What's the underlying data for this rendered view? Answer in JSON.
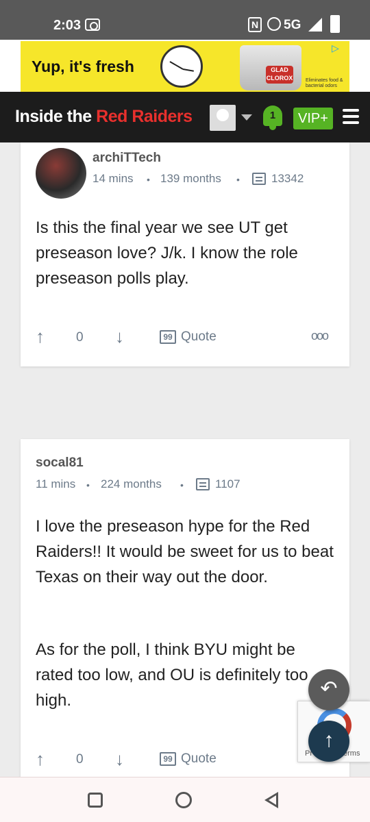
{
  "status_bar": {
    "time": "2:03",
    "network": "5G",
    "nfc_label": "N"
  },
  "ad": {
    "headline": "Yup, it's fresh",
    "brand": "GLAD",
    "sub_brand": "CLOROX",
    "fine_print": "Eliminates food & bacterial odors",
    "choice_icon": "adchoices-icon"
  },
  "site": {
    "name_white": "Inside the",
    "name_red": "Red Raiders",
    "notification_count": "1",
    "vip_label": "VIP+",
    "accent_color": "#56b324",
    "brand_red": "#e8302d"
  },
  "posts": [
    {
      "username": "archiTTech",
      "time_ago": "14 mins",
      "member_for": "139 months",
      "post_count": "13342",
      "paragraphs": [
        "Is this the final year we see UT get preseason love? J/k. I know the role preseason polls play."
      ],
      "votes": "0",
      "quote_label": "Quote",
      "more_label": "ooo"
    },
    {
      "username": "socal81",
      "time_ago": "11 mins",
      "member_for": "224 months",
      "post_count": "1107",
      "paragraphs": [
        "I love the preseason hype for the Red Raiders!! It would be sweet for us to beat Texas on their way out the door.",
        "As for the poll, I think BYU might be rated too low, and OU is definitely too high."
      ],
      "votes": "0",
      "quote_label": "Quote"
    }
  ],
  "recaptcha": {
    "left_text": "Pr",
    "right_text": "erms"
  },
  "fab": {
    "reply_icon": "reply-icon",
    "top_icon": "arrow-up-icon"
  },
  "dot": "•",
  "arrows": {
    "up": "↑",
    "down": "↓"
  }
}
